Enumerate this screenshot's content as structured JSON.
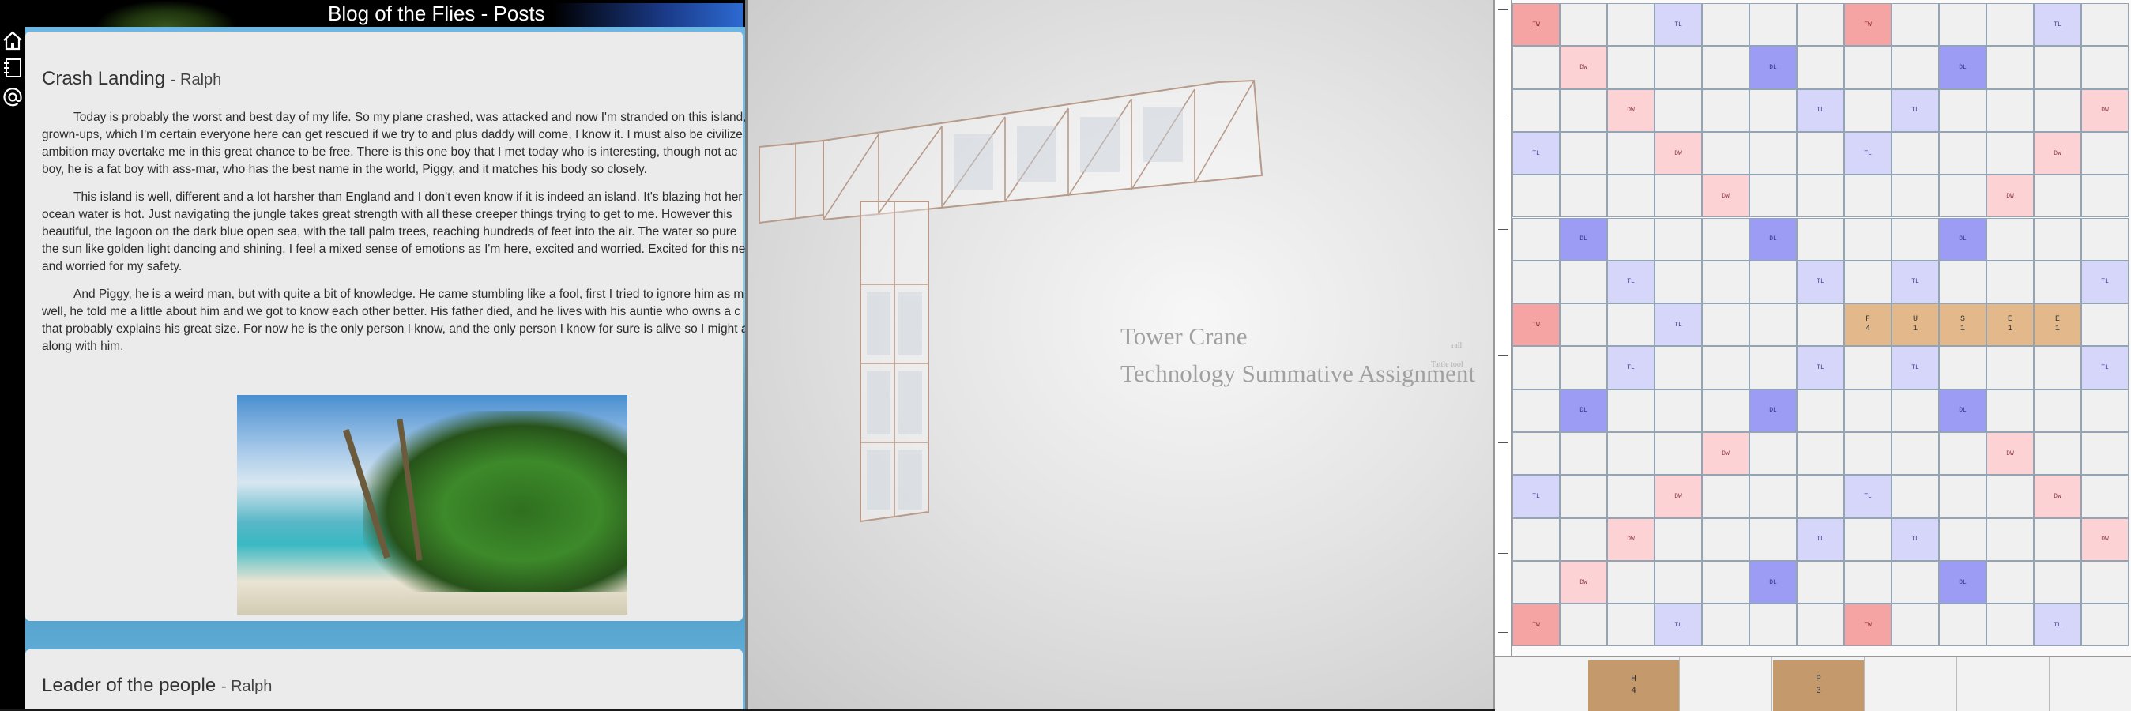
{
  "blog": {
    "header_title": "Blog of the Flies - Posts",
    "nav": [
      {
        "icon": "home-icon"
      },
      {
        "icon": "notebook-icon"
      },
      {
        "icon": "at-sign-icon"
      }
    ],
    "posts": [
      {
        "title": "Crash Landing",
        "author": "- Ralph",
        "paragraphs": [
          "Today is probably the worst and best day of my life. So my plane crashed, was attacked and now I'm stranded on this island, grown-ups, which I'm certain everyone here can get rescued if we try to and plus daddy will come, I know it. I must also be civilize ambition may overtake me in this great chance to be free. There is this one boy that I met today who is interesting, though not ac boy, he is a fat boy with ass-mar, who has the best name in the world, Piggy, and it matches his body so closely.",
          "This island is well, different and a lot harsher than England and I don't even know if it is indeed an island. It's blazing hot her ocean water is hot. Just navigating the jungle takes great strength with all these creeper things trying to get to me. However this beautiful, the lagoon on the dark blue open sea, with the tall palm trees, reaching hundreds of feet into the air. The water so pure the sun like golden light dancing and shining. I feel a mixed sense of emotions as I'm here, excited and worried. Excited for this ne and worried for my safety.",
          "And Piggy, he is a weird man, but with quite a bit of knowledge. He came stumbling like a fool, first I tried to ignore him as m well, he told me a little about him and we got to know each other better. His father died, and he lives with his auntie who owns a c that probably explains his great size. For now he is the only person I know, and the only person I know for sure is alive so I might a along with him."
        ]
      },
      {
        "title": "Leader of the people",
        "author": "- Ralph"
      }
    ]
  },
  "prezi": {
    "title": "Tower Crane",
    "subtitle": "Technology Summative Assignment",
    "mini_text_1": "rall",
    "mini_text_2": "Tattle tool"
  },
  "board": {
    "premiums": [
      "TW",
      "DW",
      "DL",
      "TL"
    ],
    "placed_tiles": [
      {
        "letter": "F",
        "score": "4"
      },
      {
        "letter": "U",
        "score": "1"
      },
      {
        "letter": "S",
        "score": "1"
      },
      {
        "letter": "E",
        "score": "1"
      },
      {
        "letter": "E",
        "score": "1"
      }
    ],
    "rack_tiles": [
      {
        "letter": "H",
        "score": "4"
      },
      {
        "letter": "P",
        "score": "3"
      }
    ]
  },
  "colors": {
    "triple_word": "#f6a3a3",
    "double_word": "#fcd2d4",
    "double_letter": "#9c9cf5",
    "triple_letter": "#d6d6fb",
    "tile": "#e3b98c",
    "rack_tile": "#c49a6c"
  }
}
